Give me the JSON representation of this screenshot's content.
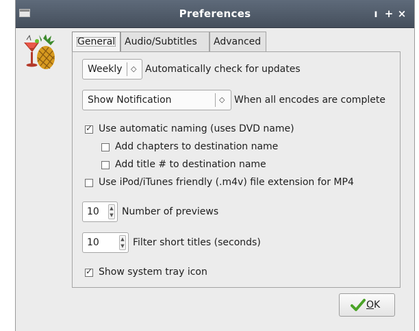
{
  "window": {
    "title": "Preferences",
    "controls": {
      "minimize": "ı",
      "maximize": "+",
      "close": "×"
    }
  },
  "tabs": [
    {
      "label": "General",
      "active": true
    },
    {
      "label": "Audio/Subtitles",
      "active": false
    },
    {
      "label": "Advanced",
      "active": false
    }
  ],
  "general": {
    "update_check": {
      "selected": "Weekly",
      "label": "Automatically check for updates"
    },
    "encodes_complete": {
      "selected": "Show Notification",
      "label": "When all encodes are complete"
    },
    "checkboxes": {
      "auto_naming": {
        "label": "Use automatic naming (uses DVD name)",
        "checked": true
      },
      "add_chapters": {
        "label": "Add chapters to destination name",
        "checked": false
      },
      "add_title": {
        "label": "Add title # to destination name",
        "checked": false
      },
      "ipod_extension": {
        "label": "Use iPod/iTunes friendly (.m4v) file extension for MP4",
        "checked": false
      },
      "tray_icon": {
        "label": "Show system tray icon",
        "checked": true
      }
    },
    "previews": {
      "value": "10",
      "label": "Number of previews"
    },
    "short_titles": {
      "value": "10",
      "label": "Filter short titles (seconds)"
    }
  },
  "buttons": {
    "ok_mnemonic": "O",
    "ok_rest": "K"
  },
  "colors": {
    "titlebar": "#4f5a68",
    "ok_tick": "#4aa327"
  }
}
